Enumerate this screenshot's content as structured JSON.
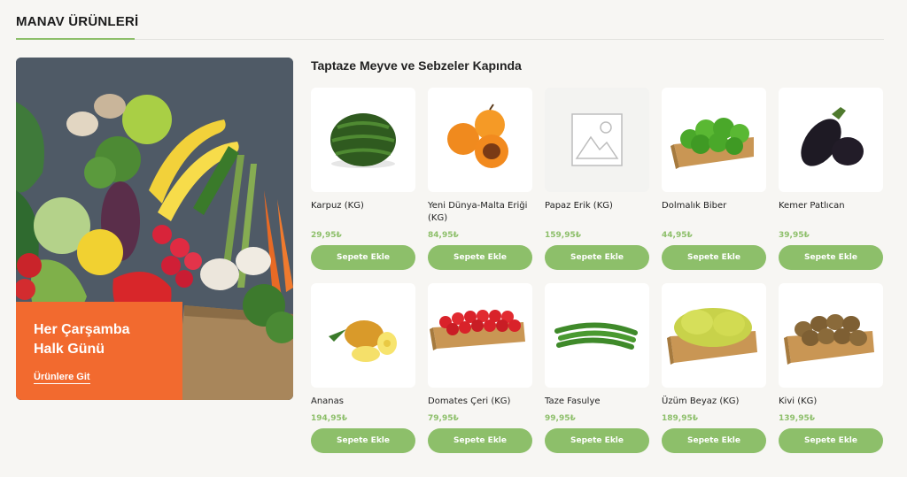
{
  "section": {
    "title": "MANAV ÜRÜNLERİ"
  },
  "banner": {
    "title": "Her Çarşamba\nHalk Günü",
    "link_label": "Ürünlere Git"
  },
  "grid_title": "Taptaze Meyve ve Sebzeler Kapında",
  "products": [
    {
      "name": "Karpuz (KG)",
      "price": "29,95₺",
      "button": "Sepete Ekle",
      "icon": "watermelon-icon"
    },
    {
      "name": "Yeni Dünya-Malta Eriği (KG)",
      "price": "84,95₺",
      "button": "Sepete Ekle",
      "icon": "loquat-icon"
    },
    {
      "name": "Papaz Erik (KG)",
      "price": "159,95₺",
      "button": "Sepete Ekle",
      "icon": "image-placeholder-icon"
    },
    {
      "name": "Dolmalık Biber",
      "price": "44,95₺",
      "button": "Sepete Ekle",
      "icon": "green-pepper-icon"
    },
    {
      "name": "Kemer Patlıcan",
      "price": "39,95₺",
      "button": "Sepete Ekle",
      "icon": "eggplant-icon"
    },
    {
      "name": "Ananas",
      "price": "194,95₺",
      "button": "Sepete Ekle",
      "icon": "pineapple-icon"
    },
    {
      "name": "Domates Çeri (KG)",
      "price": "79,95₺",
      "button": "Sepete Ekle",
      "icon": "cherry-tomato-icon"
    },
    {
      "name": "Taze Fasulye",
      "price": "99,95₺",
      "button": "Sepete Ekle",
      "icon": "green-bean-icon"
    },
    {
      "name": "Üzüm Beyaz (KG)",
      "price": "189,95₺",
      "button": "Sepete Ekle",
      "icon": "white-grape-icon"
    },
    {
      "name": "Kivi (KG)",
      "price": "139,95₺",
      "button": "Sepete Ekle",
      "icon": "kiwi-icon"
    }
  ],
  "colors": {
    "accent": "#8dbf6a",
    "banner": "#f26a2f"
  }
}
